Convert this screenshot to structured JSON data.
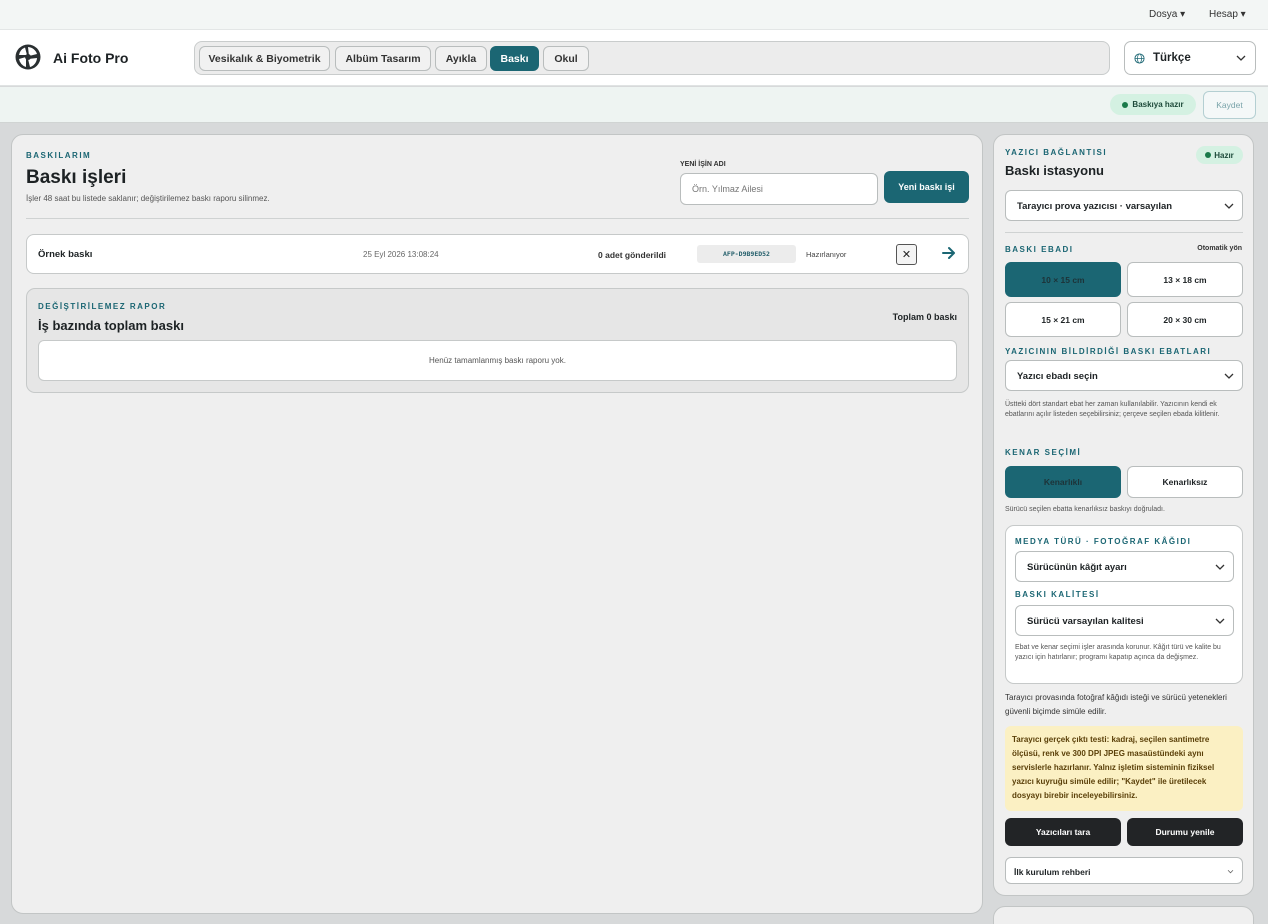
{
  "menubar": {
    "file": "Dosya ▾",
    "account": "Hesap ▾"
  },
  "header": {
    "app_title": "Ai Foto Pro",
    "tabs": [
      {
        "label": "Vesikalık & Biyometrik",
        "active": false
      },
      {
        "label": "Albüm Tasarım",
        "active": false
      },
      {
        "label": "Ayıkla",
        "active": false
      },
      {
        "label": "Baskı",
        "active": true
      },
      {
        "label": "Okul",
        "active": false
      }
    ],
    "language": "Türkçe"
  },
  "statusbar": {
    "ready": "Baskıya hazır",
    "save": "Kaydet"
  },
  "main": {
    "eyebrow": "BASKILARIM",
    "title": "Baskı işleri",
    "subtitle": "İşler 48 saat bu listede saklanır; değiştirilemez baskı raporu silinmez.",
    "job_name_label": "YENİ İŞİN ADI",
    "job_name_placeholder": "Örn. Yılmaz Ailesi",
    "new_job_button": "Yeni baskı işi",
    "jobs": [
      {
        "name": "Örnek baskı",
        "date": "25 Eyl 2026 13:08:24",
        "sent": "0 adet gönderildi",
        "code": "AFP-D9B9ED52",
        "state": "Hazırlanıyor"
      }
    ],
    "report": {
      "eyebrow": "DEĞİŞTİRİLEMEZ RAPOR",
      "title": "İş bazında toplam baskı",
      "total": "Toplam 0 baskı",
      "empty": "Henüz tamamlanmış baskı raporu yok."
    }
  },
  "side": {
    "eyebrow": "YAZICI BAĞLANTISI",
    "status": "Hazır",
    "title": "Baskı istasyonu",
    "printer_select": "Tarayıcı prova yazıcısı · varsayılan",
    "size_label": "BASKI EBADI",
    "auto_orient": "Otomatik yön",
    "sizes": [
      {
        "label": "10 × 15 cm",
        "selected": true
      },
      {
        "label": "13 × 18 cm",
        "selected": false
      },
      {
        "label": "15 × 21 cm",
        "selected": false
      },
      {
        "label": "20 × 30 cm",
        "selected": false
      }
    ],
    "printer_sizes_label": "YAZICININ BİLDİRDİĞİ BASKI EBATLARI",
    "printer_size_select": "Yazıcı ebadı seçin",
    "printer_sizes_note": "Üstteki dört standart ebat her zaman kullanılabilir. Yazıcının kendi ek ebatlarını açılır listeden seçebilirsiniz; çerçeve seçilen ebada kilitlenir.",
    "border_label": "KENAR SEÇİMİ",
    "borders": [
      {
        "label": "Kenarlıklı",
        "selected": true
      },
      {
        "label": "Kenarlıksız",
        "selected": false
      }
    ],
    "border_note": "Sürücü seçilen ebatta kenarlıksız baskıyı doğruladı.",
    "media_label": "MEDYA TÜRÜ · FOTOĞRAF KÂĞIDI",
    "media_select": "Sürücünün kâğıt ayarı",
    "quality_label": "BASKI KALİTESİ",
    "quality_select": "Sürücü varsayılan kalitesi",
    "media_note": "Ebat ve kenar seçimi işler arasında korunur. Kâğıt türü ve kalite bu yazıcı için hatırlanır; programı kapatıp açınca da değişmez.",
    "sim_text": "Tarayıcı provasında fotoğraf kâğıdı isteği ve sürücü yetenekleri güvenli biçimde simüle edilir.",
    "warning": "Tarayıcı gerçek çıktı testi: kadraj, seçilen santimetre ölçüsü, renk ve 300 DPI JPEG masaüstündeki aynı servislerle hazırlanır. Yalnız işletim sisteminin fiziksel yazıcı kuyruğu simüle edilir; \"Kaydet\" ile üretilecek dosyayı birebir inceleyebilirsiniz.",
    "scan_button": "Yazıcıları tara",
    "refresh_button": "Durumu yenile",
    "guide": "İlk kurulum rehberi"
  },
  "colors": {
    "accent": "#1b6673",
    "ready_bg": "#d4f1e2",
    "warning_bg": "#fbf0c3"
  }
}
